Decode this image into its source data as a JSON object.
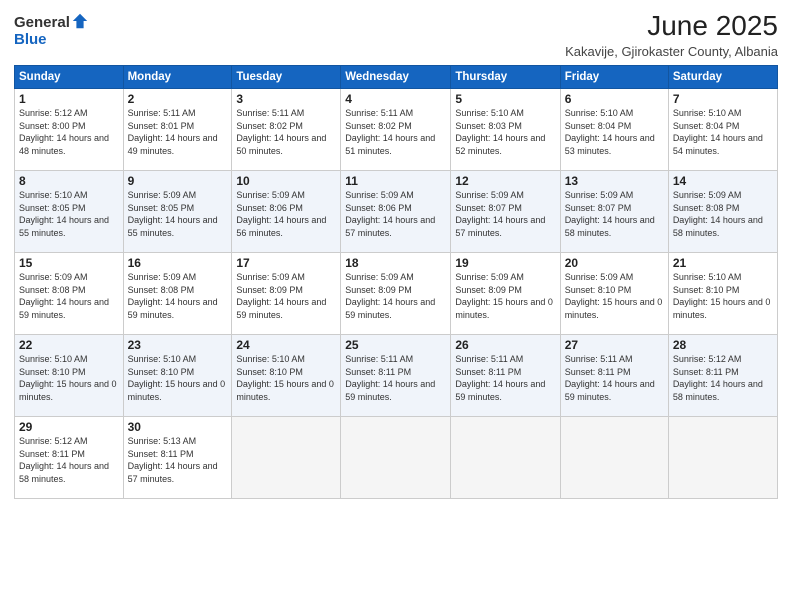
{
  "logo": {
    "general": "General",
    "blue": "Blue"
  },
  "title": "June 2025",
  "location": "Kakavije, Gjirokaster County, Albania",
  "days_of_week": [
    "Sunday",
    "Monday",
    "Tuesday",
    "Wednesday",
    "Thursday",
    "Friday",
    "Saturday"
  ],
  "weeks": [
    [
      {
        "day": "1",
        "sunrise": "5:12 AM",
        "sunset": "8:00 PM",
        "daylight": "14 hours and 48 minutes."
      },
      {
        "day": "2",
        "sunrise": "5:11 AM",
        "sunset": "8:01 PM",
        "daylight": "14 hours and 49 minutes."
      },
      {
        "day": "3",
        "sunrise": "5:11 AM",
        "sunset": "8:02 PM",
        "daylight": "14 hours and 50 minutes."
      },
      {
        "day": "4",
        "sunrise": "5:11 AM",
        "sunset": "8:02 PM",
        "daylight": "14 hours and 51 minutes."
      },
      {
        "day": "5",
        "sunrise": "5:10 AM",
        "sunset": "8:03 PM",
        "daylight": "14 hours and 52 minutes."
      },
      {
        "day": "6",
        "sunrise": "5:10 AM",
        "sunset": "8:04 PM",
        "daylight": "14 hours and 53 minutes."
      },
      {
        "day": "7",
        "sunrise": "5:10 AM",
        "sunset": "8:04 PM",
        "daylight": "14 hours and 54 minutes."
      }
    ],
    [
      {
        "day": "8",
        "sunrise": "5:10 AM",
        "sunset": "8:05 PM",
        "daylight": "14 hours and 55 minutes."
      },
      {
        "day": "9",
        "sunrise": "5:09 AM",
        "sunset": "8:05 PM",
        "daylight": "14 hours and 55 minutes."
      },
      {
        "day": "10",
        "sunrise": "5:09 AM",
        "sunset": "8:06 PM",
        "daylight": "14 hours and 56 minutes."
      },
      {
        "day": "11",
        "sunrise": "5:09 AM",
        "sunset": "8:06 PM",
        "daylight": "14 hours and 57 minutes."
      },
      {
        "day": "12",
        "sunrise": "5:09 AM",
        "sunset": "8:07 PM",
        "daylight": "14 hours and 57 minutes."
      },
      {
        "day": "13",
        "sunrise": "5:09 AM",
        "sunset": "8:07 PM",
        "daylight": "14 hours and 58 minutes."
      },
      {
        "day": "14",
        "sunrise": "5:09 AM",
        "sunset": "8:08 PM",
        "daylight": "14 hours and 58 minutes."
      }
    ],
    [
      {
        "day": "15",
        "sunrise": "5:09 AM",
        "sunset": "8:08 PM",
        "daylight": "14 hours and 59 minutes."
      },
      {
        "day": "16",
        "sunrise": "5:09 AM",
        "sunset": "8:08 PM",
        "daylight": "14 hours and 59 minutes."
      },
      {
        "day": "17",
        "sunrise": "5:09 AM",
        "sunset": "8:09 PM",
        "daylight": "14 hours and 59 minutes."
      },
      {
        "day": "18",
        "sunrise": "5:09 AM",
        "sunset": "8:09 PM",
        "daylight": "14 hours and 59 minutes."
      },
      {
        "day": "19",
        "sunrise": "5:09 AM",
        "sunset": "8:09 PM",
        "daylight": "15 hours and 0 minutes."
      },
      {
        "day": "20",
        "sunrise": "5:09 AM",
        "sunset": "8:10 PM",
        "daylight": "15 hours and 0 minutes."
      },
      {
        "day": "21",
        "sunrise": "5:10 AM",
        "sunset": "8:10 PM",
        "daylight": "15 hours and 0 minutes."
      }
    ],
    [
      {
        "day": "22",
        "sunrise": "5:10 AM",
        "sunset": "8:10 PM",
        "daylight": "15 hours and 0 minutes."
      },
      {
        "day": "23",
        "sunrise": "5:10 AM",
        "sunset": "8:10 PM",
        "daylight": "15 hours and 0 minutes."
      },
      {
        "day": "24",
        "sunrise": "5:10 AM",
        "sunset": "8:10 PM",
        "daylight": "15 hours and 0 minutes."
      },
      {
        "day": "25",
        "sunrise": "5:11 AM",
        "sunset": "8:11 PM",
        "daylight": "14 hours and 59 minutes."
      },
      {
        "day": "26",
        "sunrise": "5:11 AM",
        "sunset": "8:11 PM",
        "daylight": "14 hours and 59 minutes."
      },
      {
        "day": "27",
        "sunrise": "5:11 AM",
        "sunset": "8:11 PM",
        "daylight": "14 hours and 59 minutes."
      },
      {
        "day": "28",
        "sunrise": "5:12 AM",
        "sunset": "8:11 PM",
        "daylight": "14 hours and 58 minutes."
      }
    ],
    [
      {
        "day": "29",
        "sunrise": "5:12 AM",
        "sunset": "8:11 PM",
        "daylight": "14 hours and 58 minutes."
      },
      {
        "day": "30",
        "sunrise": "5:13 AM",
        "sunset": "8:11 PM",
        "daylight": "14 hours and 57 minutes."
      },
      null,
      null,
      null,
      null,
      null
    ]
  ]
}
